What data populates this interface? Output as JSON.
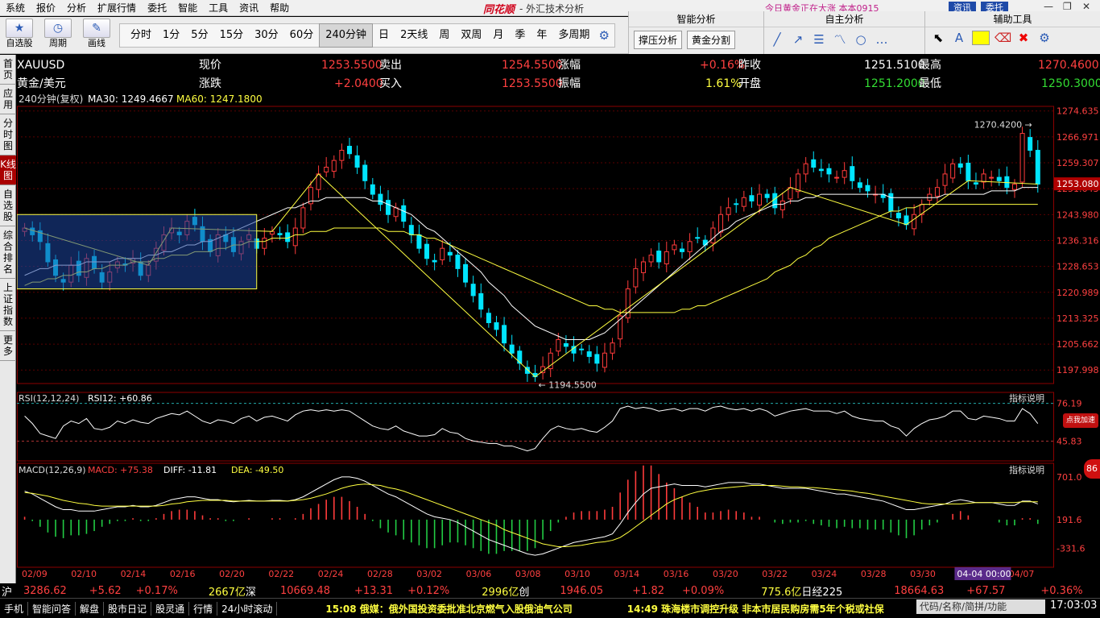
{
  "menu": [
    "系统",
    "报价",
    "分析",
    "扩展行情",
    "委托",
    "智能",
    "工具",
    "资讯",
    "帮助"
  ],
  "brand": {
    "logo": "同花顺",
    "sub": "- 外汇技术分析"
  },
  "news_flash": "今日黄金正在大涨",
  "news_user": "本本0915",
  "top_buttons": {
    "info": "资讯",
    "trade": "委托"
  },
  "left_tools": [
    {
      "icon": "star-icon",
      "label": "自选股"
    },
    {
      "icon": "period-icon",
      "label": "周期"
    },
    {
      "icon": "pen-icon",
      "label": "画线"
    }
  ],
  "periods": [
    "分时",
    "1分",
    "5分",
    "15分",
    "30分",
    "60分",
    "240分钟",
    "日",
    "2天线",
    "周",
    "双周",
    "月",
    "季",
    "年",
    "多周期"
  ],
  "active_period": "240分钟",
  "panels": {
    "smart": {
      "title": "智能分析",
      "buttons": [
        "撑压分析",
        "黄金分割"
      ]
    },
    "auto": {
      "title": "自主分析"
    },
    "aux": {
      "title": "辅助工具"
    }
  },
  "side_tabs": [
    "首页",
    "应用",
    "分时图",
    "K线图",
    "自选股",
    "综合排名",
    "上证指数",
    "更多"
  ],
  "active_side_tab": "K线图",
  "quote": {
    "symbol": "XAUUSD",
    "name": "黄金/美元",
    "row1": [
      [
        "现价",
        "1253.5500"
      ],
      [
        "卖出",
        "1254.5500"
      ],
      [
        "涨幅",
        "+0.16%"
      ],
      [
        "昨收",
        "1251.5100"
      ],
      [
        "最高",
        "1270.4600"
      ]
    ],
    "row2": [
      [
        "涨跌",
        "+2.0400"
      ],
      [
        "买入",
        "1253.5500"
      ],
      [
        "振幅",
        "1.61%"
      ],
      [
        "开盘",
        "1251.2000"
      ],
      [
        "最低",
        "1250.3000"
      ]
    ]
  },
  "ma_legend": {
    "period": "240分钟(复权)",
    "ma30": "MA30: 1249.4667",
    "ma60": "MA60: 1247.1800"
  },
  "rsi_legend": {
    "label": "RSI(12,12,24)",
    "value": "RSI12: +60.86"
  },
  "macd_legend": {
    "label": "MACD(12,26,9)",
    "macd": "MACD: +75.38",
    "diff": "DIFF: -11.81",
    "dea": "DEA: -49.50"
  },
  "indicator_help": "指标说明",
  "badge": {
    "text": "点我加速",
    "number": "86"
  },
  "chart_data": {
    "type": "candlestick",
    "price_axis": [
      "1274.635",
      "1266.971",
      "1259.307",
      "1251.643",
      "1243.980",
      "1236.316",
      "1228.653",
      "1220.989",
      "1213.325",
      "1205.662",
      "1197.998"
    ],
    "ylim": [
      1194.0,
      1276.0
    ],
    "current_price": "1253.080",
    "high_label": "1270.4200",
    "low_label": "1194.5500",
    "rsi_axis": [
      "76.19",
      "45.83"
    ],
    "macd_axis": [
      "701.0",
      "191.6",
      "-331.6"
    ],
    "x_labels": [
      "02/09",
      "02/10",
      "02/14",
      "02/16",
      "02/20",
      "02/22",
      "02/24",
      "02/28",
      "03/02",
      "03/06",
      "03/08",
      "03/10",
      "03/14",
      "03/16",
      "03/20",
      "03/22",
      "03/24",
      "03/28",
      "03/30",
      "04",
      "04/07"
    ],
    "crosshair_time": "04-04 00:00",
    "close_series": [
      1240,
      1238,
      1236,
      1230,
      1226,
      1224,
      1229,
      1226,
      1231,
      1228,
      1224,
      1227,
      1230,
      1229,
      1231,
      1226,
      1229,
      1234,
      1238,
      1240,
      1238,
      1242,
      1241,
      1236,
      1233,
      1238,
      1236,
      1233,
      1236,
      1238,
      1234,
      1237,
      1239,
      1238,
      1236,
      1240,
      1246,
      1252,
      1256,
      1258,
      1260,
      1263,
      1262,
      1258,
      1254,
      1250,
      1247,
      1244,
      1246,
      1242,
      1238,
      1234,
      1231,
      1230,
      1234,
      1232,
      1228,
      1224,
      1220,
      1216,
      1212,
      1210,
      1206,
      1203,
      1200,
      1197,
      1196,
      1199,
      1203,
      1207,
      1205,
      1203,
      1204,
      1202,
      1200,
      1203,
      1206,
      1214,
      1222,
      1228,
      1230,
      1232,
      1230,
      1233,
      1235,
      1233,
      1236,
      1237,
      1235,
      1240,
      1244,
      1246,
      1247,
      1249,
      1248,
      1250,
      1249,
      1246,
      1248,
      1252,
      1256,
      1259,
      1258,
      1257,
      1256,
      1255,
      1257,
      1254,
      1252,
      1251,
      1250,
      1249,
      1245,
      1243,
      1241,
      1244,
      1247,
      1250,
      1252,
      1256,
      1259,
      1258,
      1254,
      1253,
      1256,
      1255,
      1254,
      1252,
      1253,
      1268,
      1263,
      1253
    ],
    "rsi_series": [
      66,
      60,
      52,
      50,
      48,
      58,
      62,
      60,
      64,
      56,
      55,
      57,
      62,
      60,
      63,
      61,
      60,
      64,
      66,
      68,
      67,
      70,
      66,
      62,
      60,
      63,
      62,
      60,
      64,
      66,
      62,
      65,
      66,
      64,
      62,
      67,
      70,
      71,
      70,
      71,
      70,
      71,
      70,
      66,
      62,
      58,
      56,
      55,
      58,
      54,
      52,
      50,
      50,
      51,
      56,
      53,
      52,
      48,
      46,
      45,
      44,
      44,
      42,
      42,
      40,
      38,
      40,
      48,
      55,
      58,
      56,
      55,
      56,
      54,
      53,
      57,
      62,
      72,
      74,
      72,
      73,
      72,
      70,
      71,
      72,
      70,
      72,
      72,
      70,
      73,
      74,
      72,
      71,
      72,
      70,
      72,
      70,
      66,
      68,
      70,
      71,
      72,
      70,
      70,
      70,
      68,
      70,
      66,
      64,
      63,
      62,
      62,
      58,
      56,
      50,
      56,
      60,
      63,
      64,
      66,
      70,
      70,
      64,
      63,
      66,
      65,
      64,
      62,
      62,
      72,
      68,
      60
    ],
    "macd_diff": [
      40,
      36,
      30,
      24,
      18,
      14,
      14,
      12,
      12,
      12,
      14,
      16,
      18,
      18,
      20,
      18,
      18,
      20,
      24,
      28,
      30,
      32,
      32,
      30,
      28,
      28,
      26,
      25,
      26,
      27,
      26,
      26,
      27,
      27,
      26,
      28,
      32,
      38,
      44,
      50,
      56,
      60,
      60,
      58,
      54,
      48,
      42,
      36,
      32,
      26,
      20,
      14,
      8,
      4,
      2,
      0,
      -4,
      -10,
      -16,
      -22,
      -28,
      -32,
      -36,
      -40,
      -44,
      -48,
      -50,
      -48,
      -44,
      -40,
      -36,
      -32,
      -30,
      -28,
      -26,
      -24,
      -20,
      -6,
      10,
      24,
      36,
      44,
      46,
      48,
      50,
      48,
      48,
      48,
      46,
      48,
      50,
      52,
      52,
      52,
      50,
      50,
      48,
      46,
      44,
      44,
      44,
      44,
      42,
      40,
      38,
      36,
      36,
      34,
      32,
      30,
      28,
      26,
      22,
      18,
      14,
      14,
      16,
      18,
      20,
      22,
      26,
      28,
      26,
      24,
      24,
      24,
      22,
      20,
      20,
      26,
      26,
      22
    ],
    "macd_dea": [
      38,
      37,
      35,
      33,
      30,
      27,
      25,
      23,
      22,
      20,
      19,
      19,
      19,
      19,
      19,
      19,
      19,
      19,
      20,
      22,
      23,
      25,
      26,
      27,
      27,
      27,
      27,
      26,
      26,
      26,
      26,
      26,
      26,
      26,
      26,
      27,
      28,
      30,
      33,
      36,
      40,
      44,
      47,
      49,
      50,
      49,
      48,
      45,
      43,
      40,
      36,
      32,
      28,
      24,
      20,
      16,
      12,
      8,
      4,
      0,
      -4,
      -8,
      -14,
      -18,
      -22,
      -26,
      -30,
      -34,
      -36,
      -38,
      -38,
      -37,
      -36,
      -34,
      -32,
      -31,
      -29,
      -25,
      -18,
      -10,
      -2,
      6,
      14,
      22,
      28,
      32,
      36,
      39,
      41,
      43,
      44,
      45,
      46,
      47,
      48,
      48,
      48,
      48,
      47,
      46,
      46,
      45,
      45,
      44,
      43,
      42,
      41,
      40,
      38,
      37,
      35,
      33,
      31,
      29,
      27,
      25,
      23,
      22,
      22,
      22,
      22,
      22,
      23,
      24,
      24,
      24,
      24,
      24,
      24,
      25,
      25,
      25
    ],
    "ma30_series": [
      1226,
      1227,
      1228,
      1228,
      1229,
      1229,
      1229,
      1229,
      1230,
      1230,
      1230,
      1230,
      1231,
      1231,
      1231,
      1231,
      1232,
      1232,
      1233,
      1233,
      1234,
      1235,
      1235,
      1236,
      1236,
      1237,
      1238,
      1239,
      1240,
      1241,
      1242,
      1243,
      1244,
      1245,
      1246,
      1246,
      1247,
      1248,
      1248,
      1249,
      1249,
      1249,
      1249,
      1249,
      1249,
      1248,
      1248,
      1247,
      1246,
      1245,
      1244,
      1242,
      1240,
      1239,
      1237,
      1235,
      1233,
      1231,
      1229,
      1227,
      1224,
      1222,
      1220,
      1217,
      1215,
      1213,
      1211,
      1210,
      1209,
      1208,
      1207,
      1207,
      1207,
      1207,
      1208,
      1209,
      1211,
      1213,
      1215,
      1217,
      1219,
      1221,
      1223,
      1225,
      1227,
      1229,
      1231,
      1233,
      1235,
      1237,
      1239,
      1240,
      1242,
      1243,
      1244,
      1245,
      1246,
      1247,
      1247,
      1248,
      1248,
      1249,
      1249,
      1250,
      1250,
      1250,
      1250,
      1250,
      1250,
      1250,
      1250,
      1250,
      1249,
      1249,
      1249,
      1249,
      1249,
      1249,
      1249,
      1250,
      1250,
      1250,
      1250,
      1250,
      1250,
      1251,
      1251,
      1251,
      1251,
      1252,
      1252,
      1252
    ],
    "ma60_series": [
      1223,
      1224,
      1224,
      1225,
      1225,
      1226,
      1226,
      1227,
      1227,
      1228,
      1228,
      1229,
      1229,
      1229,
      1230,
      1230,
      1230,
      1231,
      1231,
      1232,
      1232,
      1232,
      1233,
      1233,
      1233,
      1234,
      1234,
      1235,
      1235,
      1236,
      1236,
      1236,
      1237,
      1237,
      1237,
      1238,
      1238,
      1239,
      1239,
      1239,
      1240,
      1240,
      1240,
      1240,
      1240,
      1240,
      1240,
      1239,
      1239,
      1239,
      1238,
      1238,
      1237,
      1237,
      1236,
      1235,
      1234,
      1233,
      1232,
      1231,
      1230,
      1229,
      1228,
      1227,
      1226,
      1225,
      1224,
      1223,
      1222,
      1221,
      1220,
      1219,
      1218,
      1217,
      1217,
      1216,
      1216,
      1215,
      1215,
      1215,
      1215,
      1215,
      1215,
      1215,
      1215,
      1216,
      1216,
      1217,
      1217,
      1218,
      1219,
      1220,
      1221,
      1222,
      1223,
      1224,
      1225,
      1227,
      1228,
      1229,
      1231,
      1232,
      1234,
      1235,
      1237,
      1238,
      1239,
      1240,
      1241,
      1242,
      1243,
      1244,
      1245,
      1245,
      1246,
      1246,
      1247,
      1247,
      1247,
      1247,
      1247,
      1247,
      1247,
      1247,
      1247,
      1247,
      1247,
      1247,
      1247,
      1247,
      1247,
      1247
    ]
  },
  "status": {
    "sh": "沪",
    "sh_val": "3286.62",
    "sh_chg": "+5.62",
    "sh_pct": "+0.17%",
    "sh_amt": "2667亿",
    "sz": "深",
    "sz_val": "10669.48",
    "sz_chg": "+13.31",
    "sz_pct": "+0.12%",
    "sz_amt": "2996亿",
    "cy": "创",
    "cy_val": "1946.05",
    "cy_chg": "+1.82",
    "cy_pct": "+0.09%",
    "cy_amt": "775.6亿",
    "nk": "日经225",
    "nk_val": "18664.63",
    "nk_chg": "+67.57",
    "nk_pct": "+0.36%"
  },
  "bottom": {
    "tabs": [
      "手机",
      "智能问答",
      "解盘",
      "股市日记",
      "股灵通",
      "行情",
      "24小时滚动"
    ],
    "news1": "15:08 俄媒：俄外国投资委批准北京燃气入股俄油气公司",
    "news2": "14:49 珠海楼市调控升级 非本市居民购房需5年个税或社保",
    "search_placeholder": "代码/名称/简拼/功能",
    "clock": "17:03:03"
  }
}
